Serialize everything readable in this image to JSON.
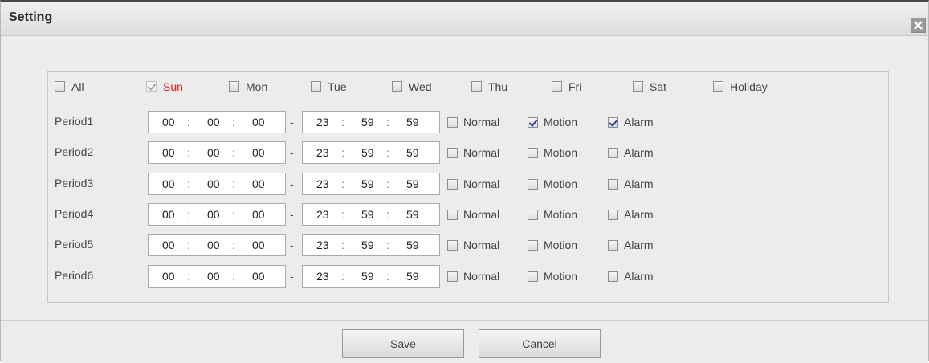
{
  "title": "Setting",
  "icons": {
    "close": "close-x-icon"
  },
  "days": [
    {
      "label": "All",
      "checked": false,
      "style": "normal"
    },
    {
      "label": "Sun",
      "checked": true,
      "style": "red-disabled"
    },
    {
      "label": "Mon",
      "checked": false,
      "style": "normal"
    },
    {
      "label": "Tue",
      "checked": false,
      "style": "normal"
    },
    {
      "label": "Wed",
      "checked": false,
      "style": "normal"
    },
    {
      "label": "Thu",
      "checked": false,
      "style": "normal"
    },
    {
      "label": "Fri",
      "checked": false,
      "style": "normal"
    },
    {
      "label": "Sat",
      "checked": false,
      "style": "normal"
    },
    {
      "label": "Holiday",
      "checked": false,
      "style": "normal"
    }
  ],
  "period_separator": "-",
  "time_separator": ":",
  "periods": [
    {
      "label": "Period1",
      "start": [
        "00",
        "00",
        "00"
      ],
      "end": [
        "23",
        "59",
        "59"
      ],
      "normal": false,
      "motion": true,
      "alarm": true
    },
    {
      "label": "Period2",
      "start": [
        "00",
        "00",
        "00"
      ],
      "end": [
        "23",
        "59",
        "59"
      ],
      "normal": false,
      "motion": false,
      "alarm": false
    },
    {
      "label": "Period3",
      "start": [
        "00",
        "00",
        "00"
      ],
      "end": [
        "23",
        "59",
        "59"
      ],
      "normal": false,
      "motion": false,
      "alarm": false
    },
    {
      "label": "Period4",
      "start": [
        "00",
        "00",
        "00"
      ],
      "end": [
        "23",
        "59",
        "59"
      ],
      "normal": false,
      "motion": false,
      "alarm": false
    },
    {
      "label": "Period5",
      "start": [
        "00",
        "00",
        "00"
      ],
      "end": [
        "23",
        "59",
        "59"
      ],
      "normal": false,
      "motion": false,
      "alarm": false
    },
    {
      "label": "Period6",
      "start": [
        "00",
        "00",
        "00"
      ],
      "end": [
        "23",
        "59",
        "59"
      ],
      "normal": false,
      "motion": false,
      "alarm": false
    }
  ],
  "record_types": [
    "Normal",
    "Motion",
    "Alarm"
  ],
  "buttons": {
    "save": "Save",
    "cancel": "Cancel"
  },
  "colors": {
    "check_blue": "#1c3fa8",
    "sun_red": "#e02020"
  }
}
